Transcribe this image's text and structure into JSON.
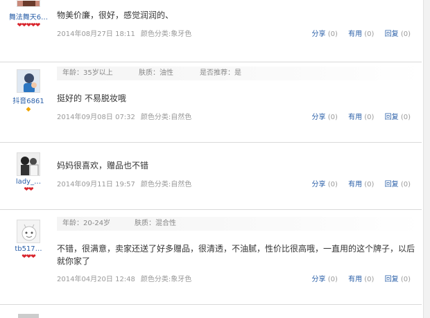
{
  "reviews": [
    {
      "username": "舞法舞天6…",
      "hearts": "❤❤❤❤❤",
      "content": "物美价廉，很好，感觉润润的、",
      "date": "2014年08月27日 18:11",
      "color": "颜色分类:象牙色",
      "share": "分享",
      "share_count": "(0)",
      "useful": "有用",
      "useful_count": "(0)",
      "reply": "回复",
      "reply_count": "(0)"
    },
    {
      "meta_age": "年龄：35岁以上",
      "meta_skin": "肤质：油性",
      "meta_recommend": "是否推荐：是",
      "username": "抖音6861",
      "badge": "◆",
      "content": "挺好的 不易脱妆哦",
      "date": "2014年09月08日 07:32",
      "color": "颜色分类:自然色",
      "share": "分享",
      "share_count": "(0)",
      "useful": "有用",
      "useful_count": "(0)",
      "reply": "回复",
      "reply_count": "(0)"
    },
    {
      "username": "lady_…",
      "hearts": "❤❤",
      "content": "妈妈很喜欢，赠品也不错",
      "date": "2014年09月11日 19:57",
      "color": "颜色分类:自然色",
      "share": "分享",
      "share_count": "(0)",
      "useful": "有用",
      "useful_count": "(0)",
      "reply": "回复",
      "reply_count": "(0)"
    },
    {
      "meta_age": "年龄：20-24岁",
      "meta_skin": "肤质：混合性",
      "username": "tb517…",
      "hearts": "❤❤❤",
      "content": "不错，很满意，卖家还送了好多赠品，很清透，不油腻，性价比很高哦，一直用的这个牌子，以后就你家了",
      "date": "2014年04月20日 12:48",
      "color": "颜色分类:象牙色",
      "share": "分享",
      "share_count": "(0)",
      "useful": "有用",
      "useful_count": "(0)",
      "reply": "回复",
      "reply_count": "(0)"
    }
  ]
}
